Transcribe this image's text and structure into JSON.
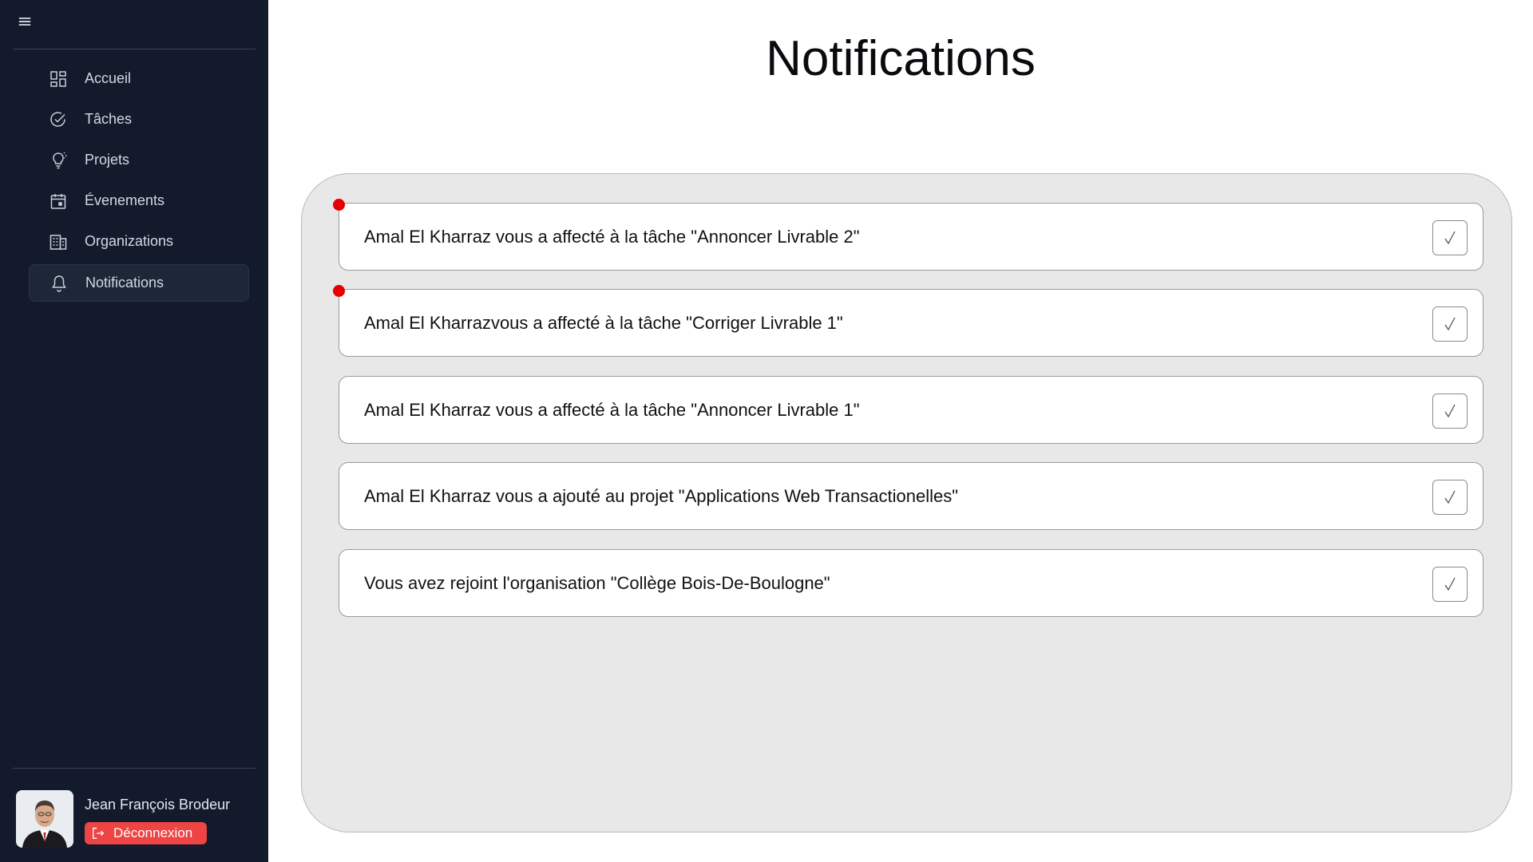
{
  "sidebar": {
    "menu_icon": "hamburger-icon",
    "items": [
      {
        "label": "Accueil",
        "icon": "dashboard-grid-icon",
        "active": false
      },
      {
        "label": "Tâches",
        "icon": "check-circle-icon",
        "active": false
      },
      {
        "label": "Projets",
        "icon": "lightbulb-icon",
        "active": false
      },
      {
        "label": "Évenements",
        "icon": "calendar-icon",
        "active": false
      },
      {
        "label": "Organizations",
        "icon": "building-icon",
        "active": false
      },
      {
        "label": "Notifications",
        "icon": "bell-icon",
        "active": true
      }
    ],
    "user": {
      "name": "Jean François Brodeur",
      "logout_label": "Déconnexion",
      "logout_icon": "logout-icon"
    }
  },
  "main": {
    "title": "Notifications",
    "notifications": [
      {
        "text": "Amal El Kharraz vous a affecté à la tâche \"Annoncer Livrable 2\"",
        "unread": true
      },
      {
        "text": "Amal El Kharrazvous a affecté à la tâche \"Corriger Livrable 1\"",
        "unread": true
      },
      {
        "text": "Amal El Kharraz vous a affecté à la tâche \"Annoncer Livrable 1\"",
        "unread": false
      },
      {
        "text": "Amal El Kharraz vous a ajouté au projet \"Applications Web Transactionelles\"",
        "unread": false
      },
      {
        "text": "Vous avez rejoint l'organisation \"Collège Bois-De-Boulogne\"",
        "unread": false
      }
    ]
  },
  "colors": {
    "sidebar_bg": "#121a2c",
    "unread_dot": "#e60000",
    "logout_bg": "#ef4444",
    "panel_bg": "#e8e8e8"
  }
}
